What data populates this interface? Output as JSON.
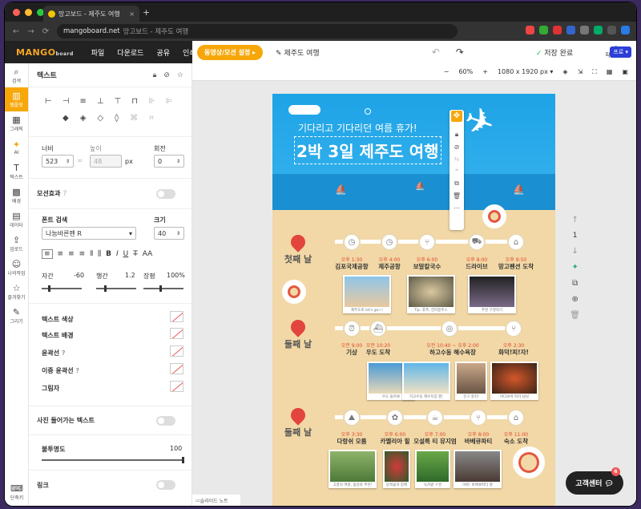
{
  "browser": {
    "tab_title": "망고보드 - 제주도 여행",
    "tab_close": "×",
    "new_tab": "+",
    "url_host": "mangoboard.net",
    "url_rest": "망고보드 - 제주도 여행",
    "nav": [
      "←",
      "→",
      "⟳"
    ]
  },
  "app": {
    "logo": "MANGO",
    "logo_small": "board",
    "menu": [
      "파일",
      "다운로드",
      "공유",
      "인쇄"
    ],
    "video_btn": "동영상/모션 설정 ▸",
    "doc_title": "제주도 여행",
    "undo": "↶",
    "redo": "↷",
    "saved": "저장 완료",
    "history": "작업내역",
    "pro": "프로 ▾"
  },
  "leftnav": [
    {
      "icon": "⌕",
      "label": "검색"
    },
    {
      "icon": "▥",
      "label": "템플릿"
    },
    {
      "icon": "▦",
      "label": "그래픽"
    },
    {
      "icon": "✦",
      "label": "AI"
    },
    {
      "icon": "T",
      "label": "텍스트"
    },
    {
      "icon": "▩",
      "label": "배경"
    },
    {
      "icon": "▤",
      "label": "데이터"
    },
    {
      "icon": "⇪",
      "label": "업로드"
    },
    {
      "icon": "☺",
      "label": "나의작업"
    },
    {
      "icon": "☆",
      "label": "즐겨찾기"
    },
    {
      "icon": "✎",
      "label": "그리기"
    }
  ],
  "shortcut": "단축키",
  "panel": {
    "title": "텍스트",
    "width_label": "너비",
    "width": "523",
    "height_label": "높이",
    "height": "48",
    "unit": "px",
    "rotate_label": "회전",
    "rotate": "0",
    "motion": "모션효과",
    "font_label": "폰트 검색",
    "font": "나눔바른펜 R",
    "size_label": "크기",
    "size": "40",
    "spacing_label": "자간",
    "spacing": "-60",
    "lineh_label": "행간",
    "lineh": "1.2",
    "stretch_label": "장평",
    "stretch": "100%",
    "text_color": "텍스트 색상",
    "text_bg": "텍스트 배경",
    "outline": "윤곽선",
    "double_outline": "이중 윤곽선",
    "shadow": "그림자",
    "photo_text": "사진 들어가는 텍스트",
    "opacity_label": "불투명도",
    "opacity": "100",
    "link": "링크",
    "format": [
      "B",
      "I",
      "U",
      "T̶",
      "AA"
    ]
  },
  "canvas": {
    "zoom": "60%",
    "minus": "−",
    "plus": "+",
    "size": "1080 x 1920 px ▾",
    "page": "1",
    "notes": "슬라이드 노트",
    "help": "고객센터",
    "help_badge": "6"
  },
  "poster": {
    "subtitle": "기다리고 기다리던 여름 휴가!",
    "title": "2박 3일 제주도 여행",
    "days": [
      "첫째 날",
      "둘째 날",
      "둘째 날"
    ],
    "rows": [
      {
        "stops": [
          {
            "time": "오후 1:30",
            "place": "김포국제공항"
          },
          {
            "time": "오후 4:00",
            "place": "제주공항"
          },
          {
            "time": "오후 6:00",
            "place": "보말칼국수"
          },
          {
            "time": "오후 8:00",
            "place": "드라이브"
          },
          {
            "time": "오후 9:50",
            "place": "망고펜션 도착"
          }
        ],
        "captions": [
          "제주도로 let's go~!",
          "Tip. 후추, 한라봉주스",
          "추천 구경하기"
        ]
      },
      {
        "stops": [
          {
            "time": "오전 9:00",
            "place": "기상"
          },
          {
            "time": "오전 10:20",
            "place": "우도 도착"
          },
          {
            "time": "오전 10:40 ~ 오후 2:00",
            "place": "하고수동 해수욕장"
          },
          {
            "time": "오후 2:30",
            "place": "화덕!피!자!"
          }
        ],
        "captions": [
          "우도 돌아봐",
          "하고수동 해수욕장 짱!",
          "친구 찰칵!",
          "바다보며 피자 냠냠"
        ]
      },
      {
        "stops": [
          {
            "time": "오후 3:30",
            "place": "다랑쉬 오름"
          },
          {
            "time": "오후 6:00",
            "place": "카멜리아 힐"
          },
          {
            "time": "오후 7:00",
            "place": "오설록 티 뮤지엄"
          },
          {
            "time": "오후 8:00",
            "place": "바베큐파티"
          },
          {
            "time": "오후 11:00",
            "place": "숙소 도착"
          }
        ],
        "captions": [
          "고풍의 여름, 숲길로 추천!",
          "동백꽃과 함께",
          "녹차밭 구경",
          "야외! 바베큐파티 짱"
        ]
      }
    ]
  }
}
